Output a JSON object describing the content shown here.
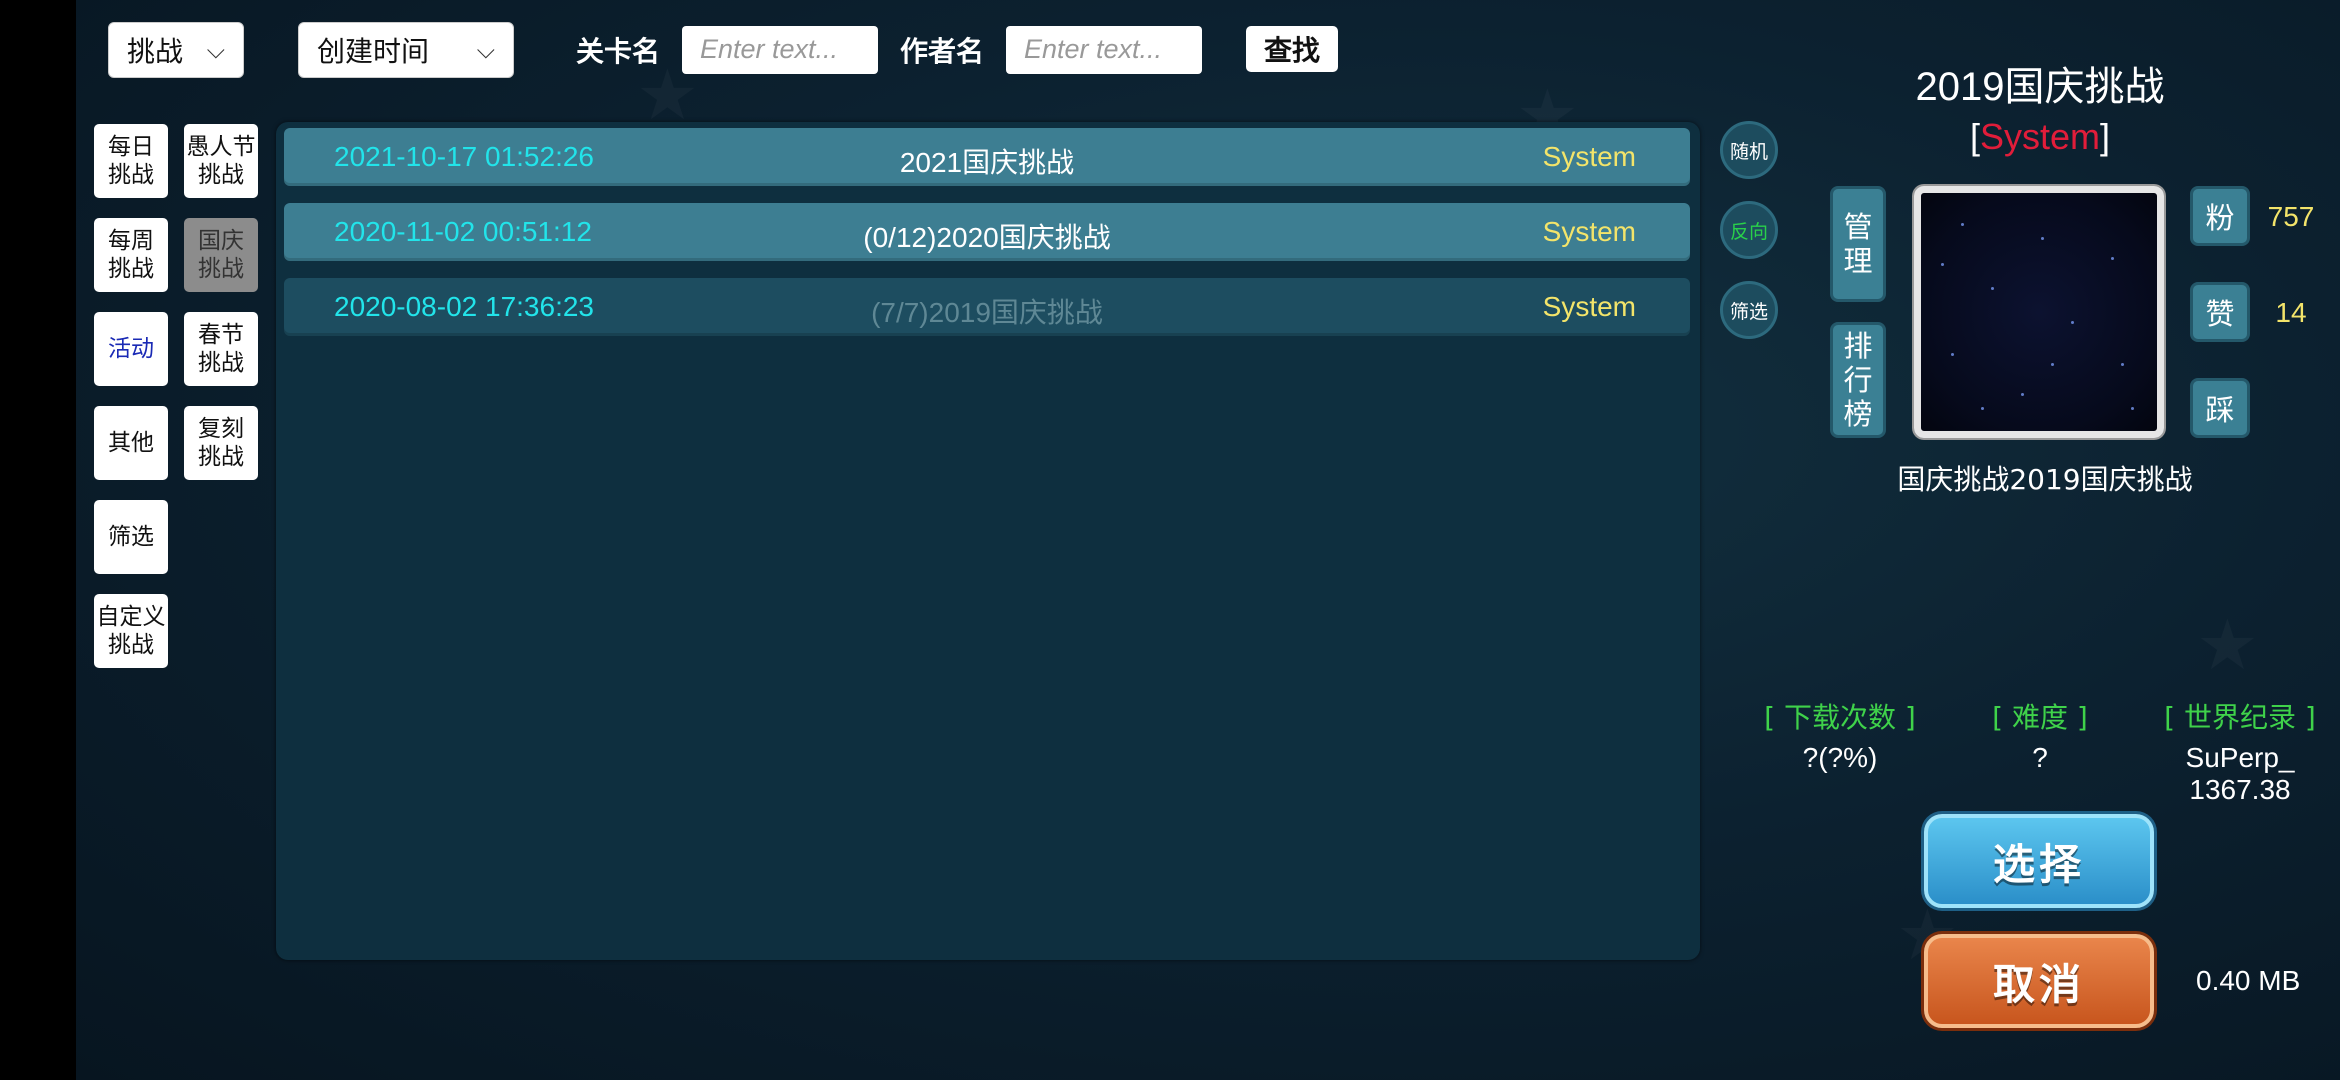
{
  "filters": {
    "type_select": "挑战",
    "sort_select": "创建时间",
    "level_name_label": "关卡名",
    "level_name_placeholder": "Enter text...",
    "author_name_label": "作者名",
    "author_name_placeholder": "Enter text...",
    "search_label": "查找"
  },
  "categories": [
    {
      "label": "每日\n挑战"
    },
    {
      "label": "愚人节\n挑战"
    },
    {
      "label": "每周\n挑战"
    },
    {
      "label": "国庆\n挑战"
    },
    {
      "label": "活动"
    },
    {
      "label": "春节\n挑战"
    },
    {
      "label": "其他"
    },
    {
      "label": "复刻\n挑战"
    },
    {
      "label": "筛选"
    },
    {
      "label": "自定义\n挑战"
    }
  ],
  "levels": [
    {
      "date": "2021-10-17 01:52:26",
      "title": "2021国庆挑战",
      "author": "System"
    },
    {
      "date": "2020-11-02 00:51:12",
      "title": "(0/12)2020国庆挑战",
      "author": "System"
    },
    {
      "date": "2020-08-02 17:36:23",
      "title": "(7/7)2019国庆挑战",
      "author": "System"
    }
  ],
  "side_actions": {
    "random": "随机",
    "reverse": "反向",
    "filter": "筛选"
  },
  "detail": {
    "title": "2019国庆挑战",
    "author_open": "[",
    "author": "System",
    "author_close": "]",
    "manage_label": "管\n理",
    "leaderboard_label": "排\n行\n榜",
    "description": "国庆挑战2019国庆挑战",
    "fans_label": "粉",
    "fans_count": "757",
    "like_label": "赞",
    "like_count": "14",
    "dislike_label": "踩",
    "downloads_header": "[ 下载次数 ]",
    "downloads_value": "?(?%)",
    "difficulty_header": "[ 难度 ]",
    "difficulty_value": "?",
    "record_header": "[ 世界纪录 ]",
    "record_holder": "SuPerp_",
    "record_value": "1367.38",
    "select_label": "选择",
    "cancel_label": "取消",
    "file_size": "0.40 MB"
  },
  "colors": {
    "background": "#0b1c2a",
    "row_active": "#3d7e92",
    "row_dim": "#1d4d60",
    "date_text": "#22e4ea",
    "author_text": "#f3e46a",
    "header_green": "#3fd24a",
    "author_red": "#e11d3a",
    "select_blue": "#2b8fc9",
    "cancel_orange": "#c8561e"
  }
}
